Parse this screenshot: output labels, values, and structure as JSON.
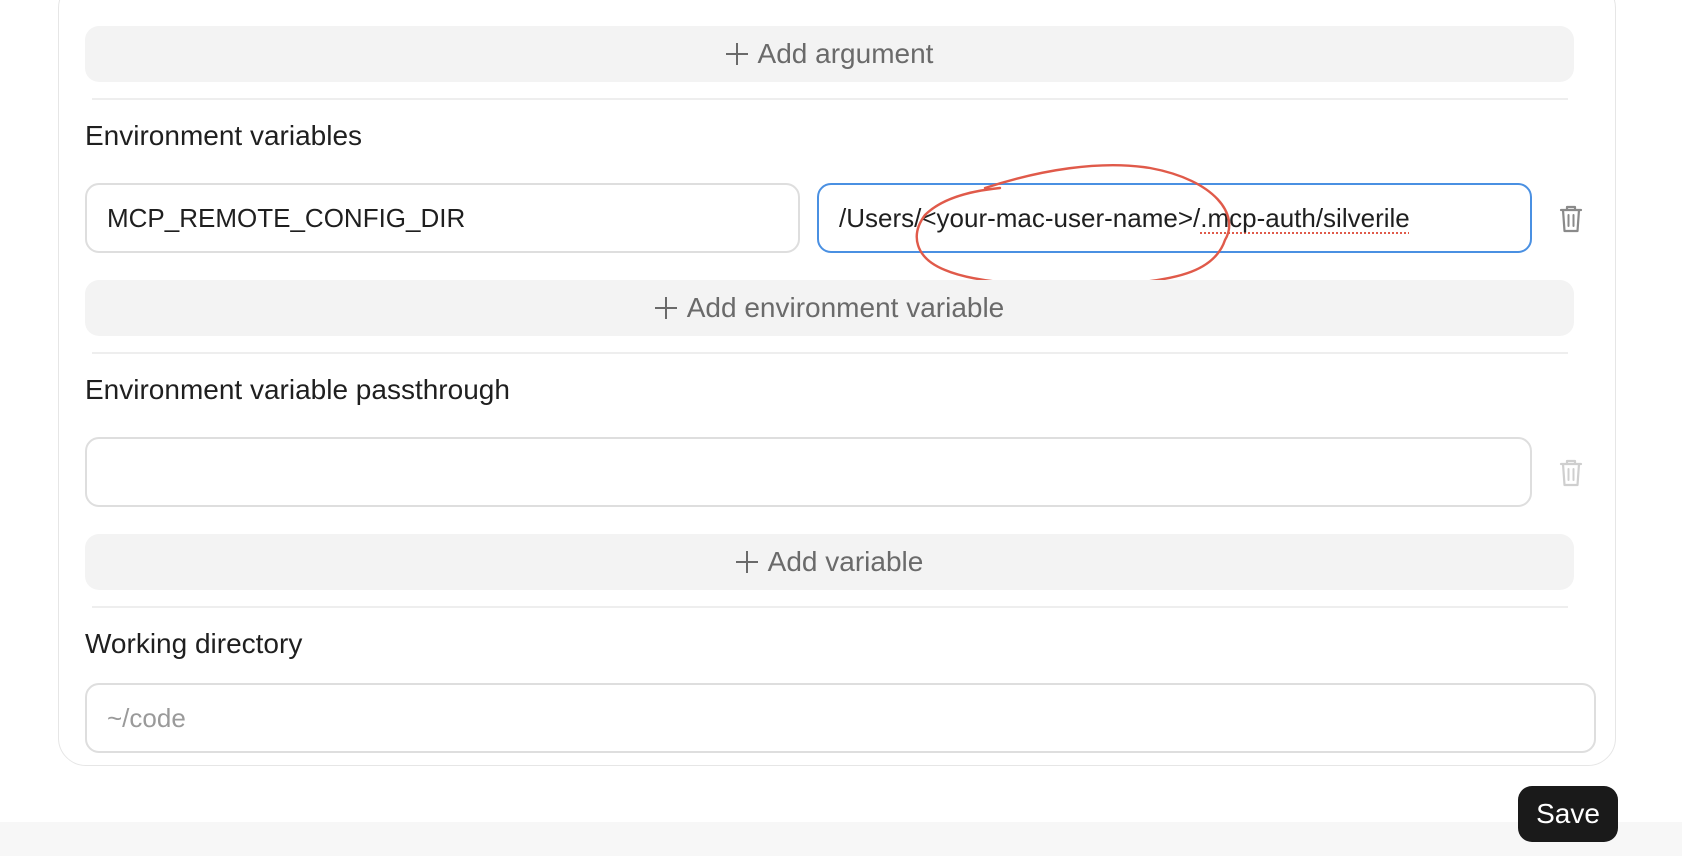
{
  "arguments": {
    "add_label": "Add argument"
  },
  "env_vars": {
    "title": "Environment variables",
    "items": [
      {
        "key": "MCP_REMOTE_CONFIG_DIR",
        "value_prefix": "/Users/",
        "value_highlight": "<your-mac-user-name>",
        "value_slash": "/",
        "value_suffix": ".mcp-auth/silverile"
      }
    ],
    "add_label": "Add environment variable"
  },
  "passthrough": {
    "title": "Environment variable passthrough",
    "value": "",
    "add_label": "Add variable"
  },
  "working_directory": {
    "title": "Working directory",
    "placeholder": "~/code"
  },
  "save_label": "Save",
  "colors": {
    "focus_border": "#4a90e2",
    "annotation": "#e05a4a",
    "save_bg": "#1a1a1a"
  },
  "icons": [
    "plus-icon",
    "trash-icon"
  ]
}
